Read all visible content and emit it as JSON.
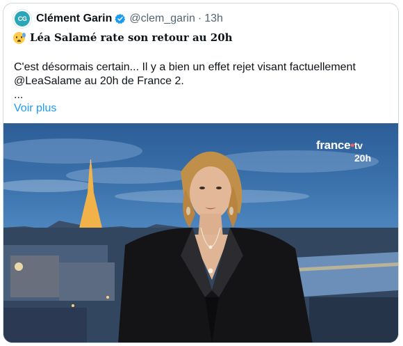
{
  "tweet": {
    "avatar_text": "CG",
    "author": "Clément Garin",
    "handle": "@clem_garin",
    "separator": "·",
    "time": "13h",
    "title": "Léa Salamé rate son retour au 20h",
    "body_lines": [
      "C'est désormais certain... Il y a bien un effet rejet visant factuellement",
      "@LeaSalame au 20h de France 2.",
      "..."
    ],
    "more_label": "Voir plus"
  },
  "media": {
    "logo": "france",
    "logo_suffix": "tv",
    "logo_sub": "20h"
  },
  "colors": {
    "link": "#1d9bf0",
    "verified": "#1d9bf0",
    "muted": "#536471",
    "border": "#cfd9de"
  }
}
